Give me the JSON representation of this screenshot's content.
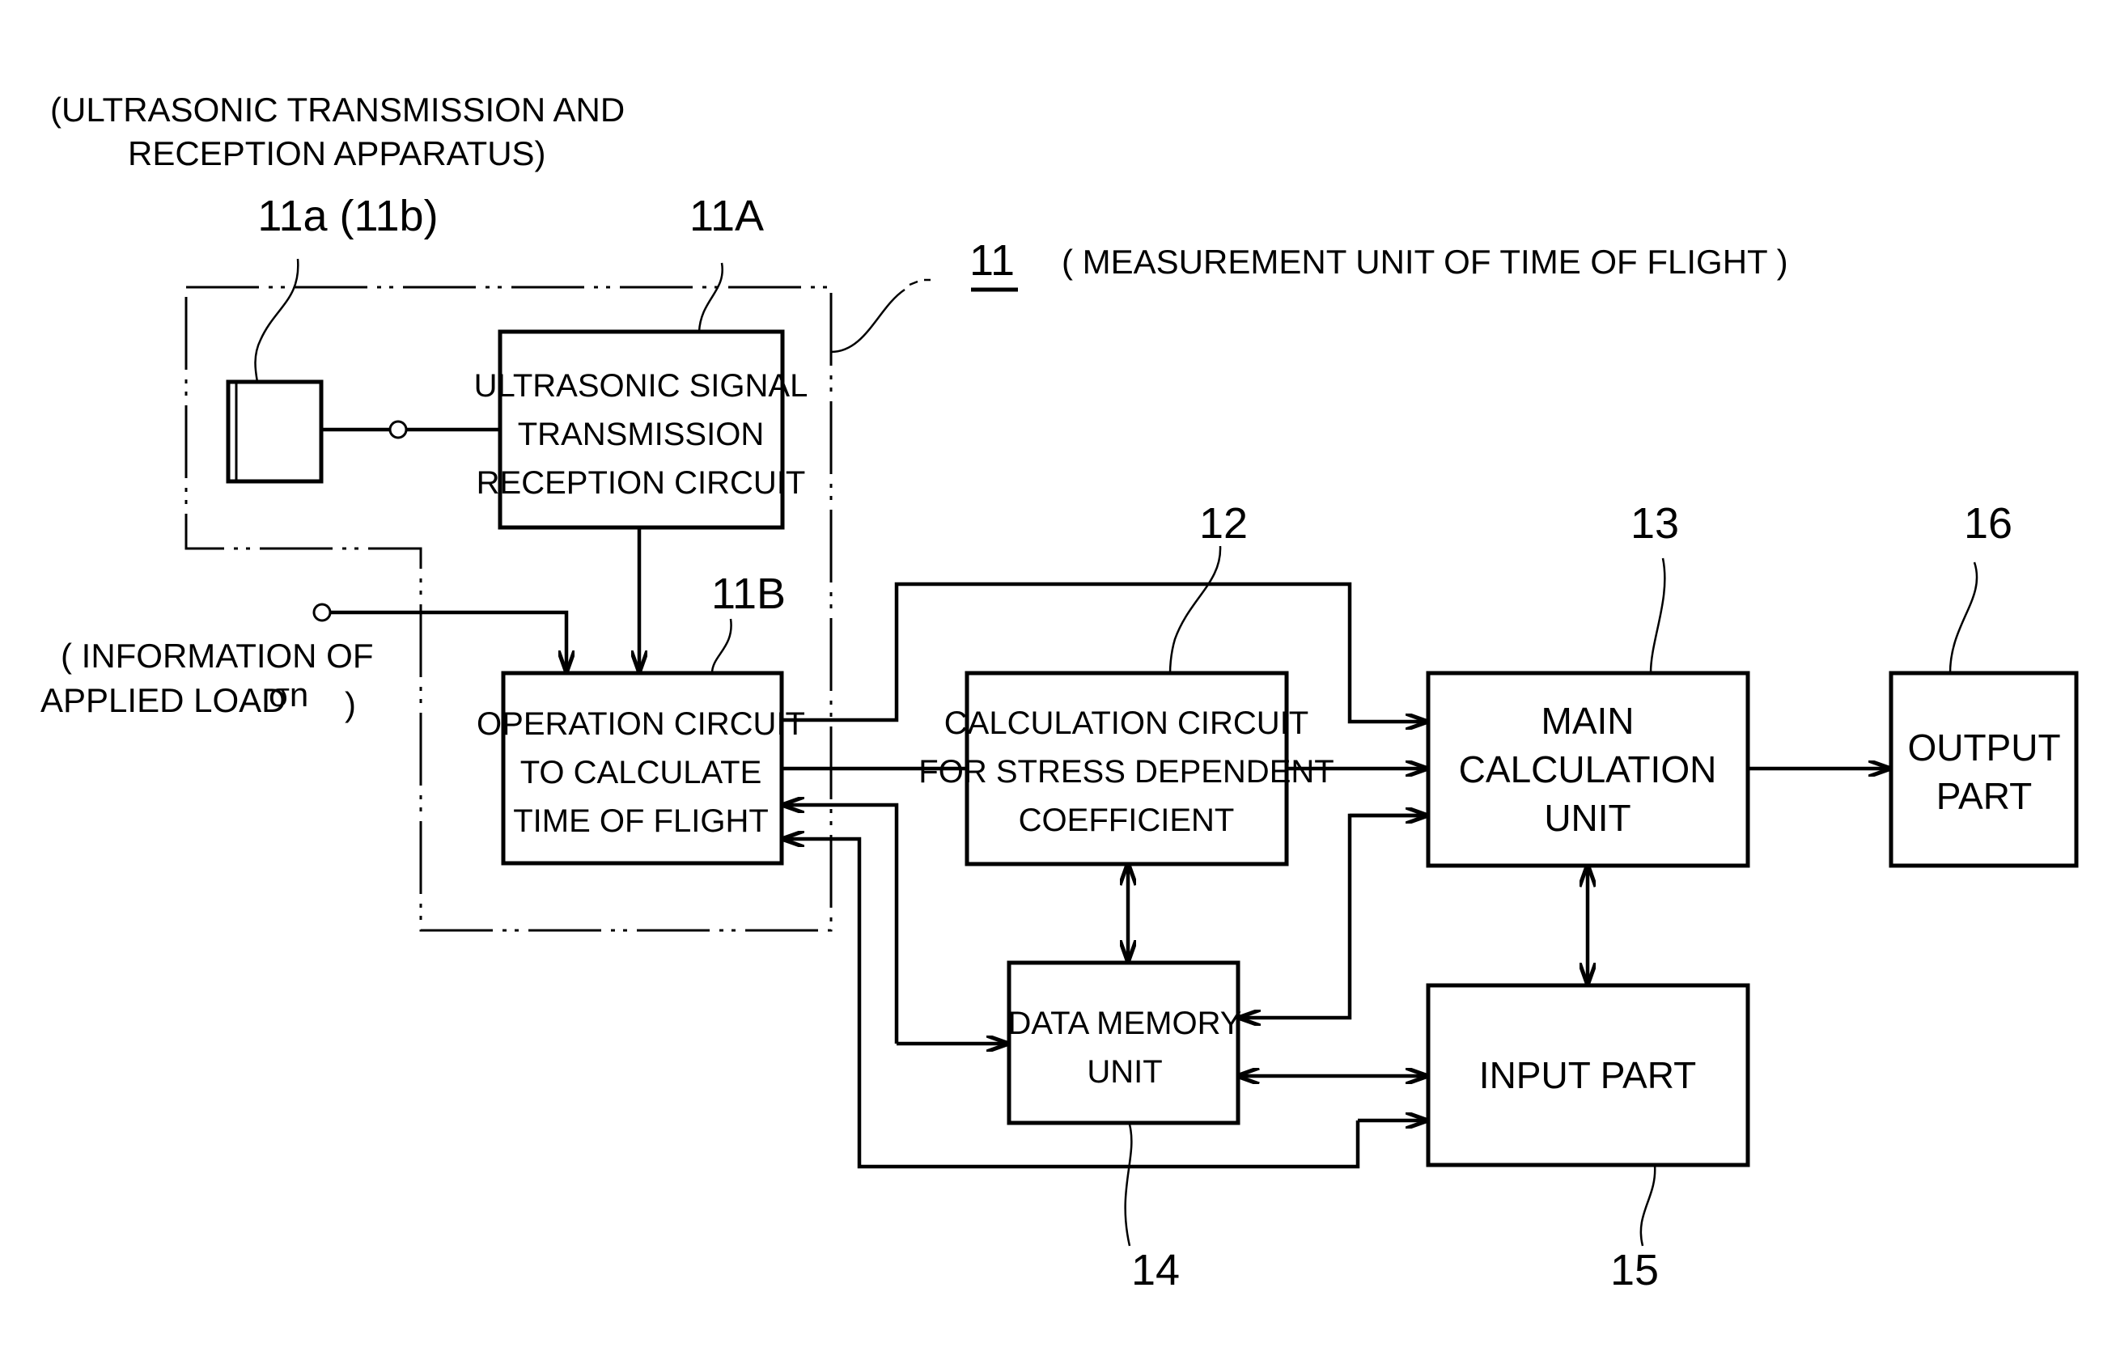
{
  "figure": {
    "annotations": {
      "apparatus_line1": "(ULTRASONIC TRANSMISSION AND",
      "apparatus_line2": "RECEPTION APPARATUS)",
      "measurement_unit": "( MEASUREMENT UNIT OF TIME OF FLIGHT )",
      "load_info_line1": "( INFORMATION OF",
      "load_info_line2": "APPLIED LOAD",
      "load_symbol": "σn",
      "load_close": ")"
    },
    "reference_numerals": {
      "transducer": "11a (11b)",
      "transmission_circuit": "11A",
      "measurement_unit": "11",
      "operation_circuit": "11B",
      "calculation_circuit": "12",
      "main_calculation": "13",
      "data_memory": "14",
      "input_part": "15",
      "output_part": "16"
    },
    "blocks": {
      "transmission_circuit": [
        "ULTRASONIC SIGNAL",
        "TRANSMISSION",
        "RECEPTION CIRCUIT"
      ],
      "operation_circuit": [
        "OPERATION CIRCUIT",
        "TO CALCULATE",
        "TIME OF FLIGHT"
      ],
      "calculation_circuit": [
        "CALCULATION CIRCUIT",
        "FOR STRESS DEPENDENT",
        "COEFFICIENT"
      ],
      "main_calculation": [
        "MAIN",
        "CALCULATION",
        "UNIT"
      ],
      "output_part": [
        "OUTPUT",
        "PART"
      ],
      "data_memory": [
        "DATA MEMORY",
        "UNIT"
      ],
      "input_part": [
        "INPUT  PART"
      ]
    }
  }
}
